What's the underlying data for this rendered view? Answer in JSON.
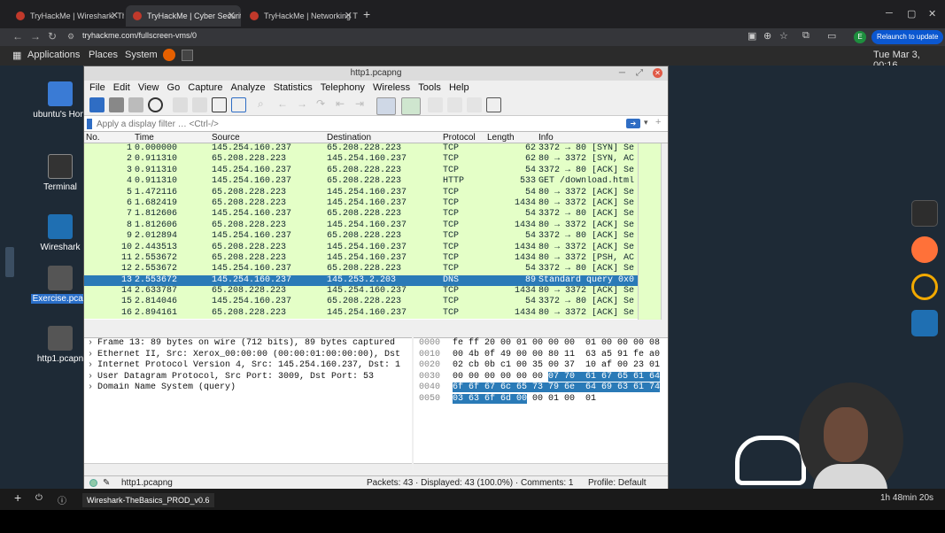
{
  "browser": {
    "tabs": [
      {
        "title": "TryHackMe | Wireshark: The Ba"
      },
      {
        "title": "TryHackMe | Cyber Security Tra"
      },
      {
        "title": "TryHackMe | Networking Traini"
      }
    ],
    "url": "tryhackme.com/fullscreen-vms/0",
    "profile_letter": "E",
    "relaunch_label": "Relaunch to update"
  },
  "desktop_topbar": {
    "applications": "Applications",
    "places": "Places",
    "system": "System",
    "clock": "Tue Mar  3, 00:16"
  },
  "desktop_icons": [
    {
      "label": "ubuntu's Hom"
    },
    {
      "label": "Terminal"
    },
    {
      "label": "Wireshark"
    },
    {
      "label": "Exercise.pcap"
    },
    {
      "label": "http1.pcapn"
    }
  ],
  "wireshark": {
    "title": "http1.pcapng",
    "menu": [
      "File",
      "Edit",
      "View",
      "Go",
      "Capture",
      "Analyze",
      "Statistics",
      "Telephony",
      "Wireless",
      "Tools",
      "Help"
    ],
    "filter_placeholder": "Apply a display filter … <Ctrl-/>",
    "columns": [
      "No.",
      "Time",
      "Source",
      "Destination",
      "Protocol",
      "Length",
      "Info"
    ],
    "packets": [
      {
        "no": "1",
        "time": "0.000000",
        "src": "145.254.160.237",
        "dst": "65.208.228.223",
        "proto": "TCP",
        "len": "62",
        "info": "3372 → 80 [SYN] Se"
      },
      {
        "no": "2",
        "time": "0.911310",
        "src": "65.208.228.223",
        "dst": "145.254.160.237",
        "proto": "TCP",
        "len": "62",
        "info": "80 → 3372 [SYN, AC"
      },
      {
        "no": "3",
        "time": "0.911310",
        "src": "145.254.160.237",
        "dst": "65.208.228.223",
        "proto": "TCP",
        "len": "54",
        "info": "3372 → 80 [ACK] Se"
      },
      {
        "no": "4",
        "time": "0.911310",
        "src": "145.254.160.237",
        "dst": "65.208.228.223",
        "proto": "HTTP",
        "len": "533",
        "info": "GET /download.html"
      },
      {
        "no": "5",
        "time": "1.472116",
        "src": "65.208.228.223",
        "dst": "145.254.160.237",
        "proto": "TCP",
        "len": "54",
        "info": "80 → 3372 [ACK] Se"
      },
      {
        "no": "6",
        "time": "1.682419",
        "src": "65.208.228.223",
        "dst": "145.254.160.237",
        "proto": "TCP",
        "len": "1434",
        "info": "80 → 3372 [ACK] Se"
      },
      {
        "no": "7",
        "time": "1.812606",
        "src": "145.254.160.237",
        "dst": "65.208.228.223",
        "proto": "TCP",
        "len": "54",
        "info": "3372 → 80 [ACK] Se"
      },
      {
        "no": "8",
        "time": "1.812606",
        "src": "65.208.228.223",
        "dst": "145.254.160.237",
        "proto": "TCP",
        "len": "1434",
        "info": "80 → 3372 [ACK] Se"
      },
      {
        "no": "9",
        "time": "2.012894",
        "src": "145.254.160.237",
        "dst": "65.208.228.223",
        "proto": "TCP",
        "len": "54",
        "info": "3372 → 80 [ACK] Se"
      },
      {
        "no": "10",
        "time": "2.443513",
        "src": "65.208.228.223",
        "dst": "145.254.160.237",
        "proto": "TCP",
        "len": "1434",
        "info": "80 → 3372 [ACK] Se"
      },
      {
        "no": "11",
        "time": "2.553672",
        "src": "65.208.228.223",
        "dst": "145.254.160.237",
        "proto": "TCP",
        "len": "1434",
        "info": "80 → 3372 [PSH, AC"
      },
      {
        "no": "12",
        "time": "2.553672",
        "src": "145.254.160.237",
        "dst": "65.208.228.223",
        "proto": "TCP",
        "len": "54",
        "info": "3372 → 80 [ACK] Se"
      },
      {
        "no": "13",
        "time": "2.553672",
        "src": "145.254.160.237",
        "dst": "145.253.2.203",
        "proto": "DNS",
        "len": "89",
        "info": "Standard query 0x0"
      },
      {
        "no": "14",
        "time": "2.633787",
        "src": "65.208.228.223",
        "dst": "145.254.160.237",
        "proto": "TCP",
        "len": "1434",
        "info": "80 → 3372 [ACK] Se"
      },
      {
        "no": "15",
        "time": "2.814046",
        "src": "145.254.160.237",
        "dst": "65.208.228.223",
        "proto": "TCP",
        "len": "54",
        "info": "3372 → 80 [ACK] Se"
      },
      {
        "no": "16",
        "time": "2.894161",
        "src": "65.208.228.223",
        "dst": "145.254.160.237",
        "proto": "TCP",
        "len": "1434",
        "info": "80 → 3372 [ACK] Se"
      }
    ],
    "selected_packet": "13",
    "details": [
      "Frame 13: 89 bytes on wire (712 bits), 89 bytes captured",
      "Ethernet II, Src: Xerox_00:00:00 (00:00:01:00:00:00), Dst",
      "Internet Protocol Version 4, Src: 145.254.160.237, Dst: 1",
      "User Datagram Protocol, Src Port: 3009, Dst Port: 53",
      "Domain Name System (query)"
    ],
    "bytes": [
      {
        "off": "0000",
        "hex": "fe ff 20 00 01 00 00 00  01 00 00 00 08"
      },
      {
        "off": "0010",
        "hex": "00 4b 0f 49 00 00 80 11  63 a5 91 fe a0"
      },
      {
        "off": "0020",
        "hex": "02 cb 0b c1 00 35 00 37  10 af 00 23 01"
      },
      {
        "off": "0030",
        "hex_plain": "00 00 00 00 00 00 ",
        "hex_hl": "07 70  61 67 65 61 64"
      },
      {
        "off": "0040",
        "hex_hl": "6f 6f 67 6c 65 73 79 6e  64 69 63 61 74"
      },
      {
        "off": "0050",
        "hex_hl": "03 63 6f 6d 00",
        "hex_plain": " 00 01 00  01"
      }
    ],
    "status": {
      "file": "http1.pcapng",
      "packets": "Packets: 43 · Displayed: 43 (100.0%) · Comments: 1",
      "profile": "Profile: Default"
    }
  },
  "bottombar": {
    "session": "Wireshark-TheBasics_PROD_v0.6",
    "timer": "1h 48min 20s"
  },
  "colors": {
    "tcp_row": "#e4ffc7",
    "selected_row": "#2a7ab7"
  }
}
